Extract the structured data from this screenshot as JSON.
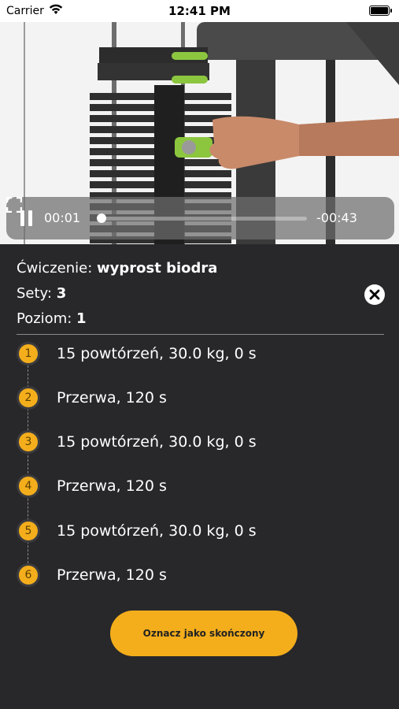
{
  "status_bar": {
    "carrier": "Carrier",
    "time": "12:41 PM",
    "battery_level": 1.0
  },
  "video": {
    "elapsed": "00:01",
    "remaining": "-00:43",
    "progress": 0.02,
    "pause_icon": "pause-icon",
    "fullscreen_icon": "fullscreen-icon"
  },
  "exercise": {
    "name_label": "Ćwiczenie:",
    "name_value": "wyprost biodra",
    "sets_label": "Sety:",
    "sets_value": "3",
    "level_label": "Poziom:",
    "level_value": "1",
    "close_icon": "close-icon"
  },
  "steps": [
    {
      "number": "1",
      "text": "15 powtórzeń, 30.0 kg, 0 s"
    },
    {
      "number": "2",
      "text": "Przerwa, 120 s"
    },
    {
      "number": "3",
      "text": "15 powtórzeń, 30.0 kg, 0 s"
    },
    {
      "number": "4",
      "text": "Przerwa, 120 s"
    },
    {
      "number": "5",
      "text": "15 powtórzeń, 30.0 kg, 0 s"
    },
    {
      "number": "6",
      "text": "Przerwa, 120 s"
    }
  ],
  "done_button": {
    "label": "Oznacz jako skończony"
  },
  "colors": {
    "accent": "#f4ae1c",
    "background": "#28282b",
    "text": "#ffffff"
  }
}
